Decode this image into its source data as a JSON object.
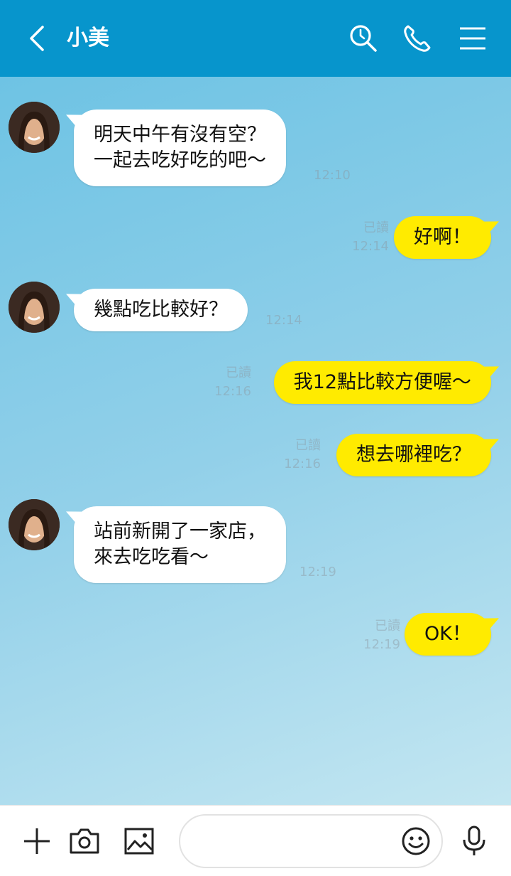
{
  "header": {
    "title": "小美",
    "bg_color": "#0795cc"
  },
  "messages": [
    {
      "from": "contact",
      "lines": [
        "明天中午有沒有空？",
        "一起去吃好吃的吧～"
      ],
      "time": "12:10"
    },
    {
      "from": "me",
      "text": "好啊！",
      "read": "已讀",
      "time": "12:14"
    },
    {
      "from": "contact",
      "lines": [
        "幾點吃比較好？"
      ],
      "time": "12:14"
    },
    {
      "from": "me",
      "text": "我12點比較方便喔～",
      "read": "已讀",
      "time": "12:16"
    },
    {
      "from": "me",
      "text": "想去哪裡吃？",
      "read": "已讀",
      "time": "12:16"
    },
    {
      "from": "contact",
      "lines": [
        "站前新開了一家店，",
        "來去吃吃看～"
      ],
      "time": "12:19"
    },
    {
      "from": "me",
      "text": "OK！",
      "read": "已讀",
      "time": "12:19"
    }
  ],
  "icons": {
    "back": "chevron-left-icon",
    "search": "search-icon",
    "call": "phone-icon",
    "menu": "hamburger-menu-icon",
    "plus": "plus-icon",
    "camera": "camera-icon",
    "image": "image-icon",
    "emoji": "smiley-icon",
    "mic": "microphone-icon"
  },
  "input": {
    "value": "",
    "placeholder": ""
  },
  "colors": {
    "outgoing_bubble": "#ffeb00",
    "incoming_bubble": "#ffffff"
  }
}
